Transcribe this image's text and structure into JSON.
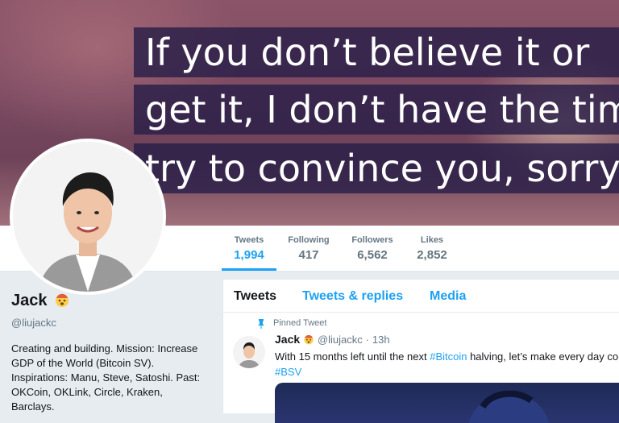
{
  "banner": {
    "lines": [
      "If you don’t believe it or",
      "get it, I don’t have the time",
      "try to convince you, sorry."
    ]
  },
  "nav": {
    "stats": [
      {
        "label": "Tweets",
        "value": "1,994"
      },
      {
        "label": "Following",
        "value": "417"
      },
      {
        "label": "Followers",
        "value": "6,562"
      },
      {
        "label": "Likes",
        "value": "2,852"
      }
    ]
  },
  "profile": {
    "name": "Jack",
    "handle": "@liujackc",
    "bio": "Creating and building. Mission: Increase GDP of the World (Bitcoin SV). Inspirations: Manu, Steve, Satoshi. Past: OKCoin, OKLink, Circle, Kraken, Barclays."
  },
  "timeline": {
    "tabs": [
      "Tweets",
      "Tweets & replies",
      "Media"
    ],
    "pinned_label": "Pinned Tweet",
    "tweet": {
      "name": "Jack",
      "handle": "@liujackc",
      "sep": "·",
      "time": "13h",
      "text_pre": "With 15 months left until the next ",
      "hashtag1": "#Bitcoin",
      "text_post": " halving, let’s make every day cou",
      "hashtag2": "#BSV"
    }
  },
  "colors": {
    "accent": "#1da1f2",
    "banner_box": "#2a1e48"
  }
}
